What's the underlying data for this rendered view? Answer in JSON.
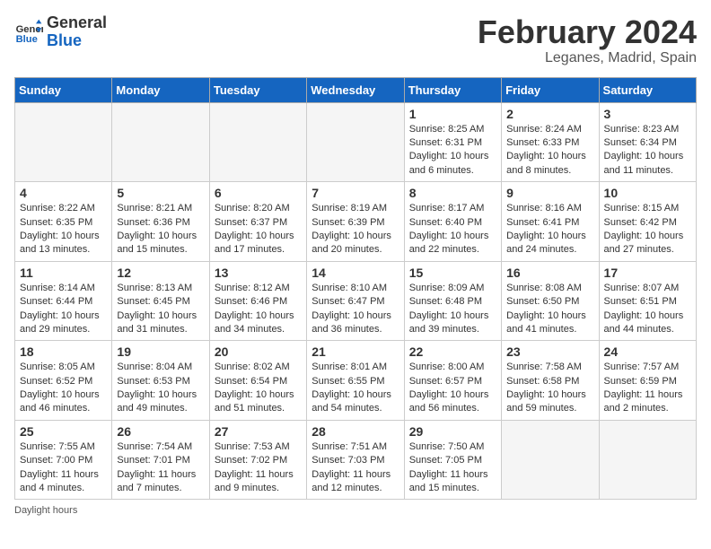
{
  "header": {
    "logo_general": "General",
    "logo_blue": "Blue",
    "title": "February 2024",
    "subtitle": "Leganes, Madrid, Spain"
  },
  "weekdays": [
    "Sunday",
    "Monday",
    "Tuesday",
    "Wednesday",
    "Thursday",
    "Friday",
    "Saturday"
  ],
  "weeks": [
    [
      {
        "day": "",
        "info": ""
      },
      {
        "day": "",
        "info": ""
      },
      {
        "day": "",
        "info": ""
      },
      {
        "day": "",
        "info": ""
      },
      {
        "day": "1",
        "info": "Sunrise: 8:25 AM\nSunset: 6:31 PM\nDaylight: 10 hours\nand 6 minutes."
      },
      {
        "day": "2",
        "info": "Sunrise: 8:24 AM\nSunset: 6:33 PM\nDaylight: 10 hours\nand 8 minutes."
      },
      {
        "day": "3",
        "info": "Sunrise: 8:23 AM\nSunset: 6:34 PM\nDaylight: 10 hours\nand 11 minutes."
      }
    ],
    [
      {
        "day": "4",
        "info": "Sunrise: 8:22 AM\nSunset: 6:35 PM\nDaylight: 10 hours\nand 13 minutes."
      },
      {
        "day": "5",
        "info": "Sunrise: 8:21 AM\nSunset: 6:36 PM\nDaylight: 10 hours\nand 15 minutes."
      },
      {
        "day": "6",
        "info": "Sunrise: 8:20 AM\nSunset: 6:37 PM\nDaylight: 10 hours\nand 17 minutes."
      },
      {
        "day": "7",
        "info": "Sunrise: 8:19 AM\nSunset: 6:39 PM\nDaylight: 10 hours\nand 20 minutes."
      },
      {
        "day": "8",
        "info": "Sunrise: 8:17 AM\nSunset: 6:40 PM\nDaylight: 10 hours\nand 22 minutes."
      },
      {
        "day": "9",
        "info": "Sunrise: 8:16 AM\nSunset: 6:41 PM\nDaylight: 10 hours\nand 24 minutes."
      },
      {
        "day": "10",
        "info": "Sunrise: 8:15 AM\nSunset: 6:42 PM\nDaylight: 10 hours\nand 27 minutes."
      }
    ],
    [
      {
        "day": "11",
        "info": "Sunrise: 8:14 AM\nSunset: 6:44 PM\nDaylight: 10 hours\nand 29 minutes."
      },
      {
        "day": "12",
        "info": "Sunrise: 8:13 AM\nSunset: 6:45 PM\nDaylight: 10 hours\nand 31 minutes."
      },
      {
        "day": "13",
        "info": "Sunrise: 8:12 AM\nSunset: 6:46 PM\nDaylight: 10 hours\nand 34 minutes."
      },
      {
        "day": "14",
        "info": "Sunrise: 8:10 AM\nSunset: 6:47 PM\nDaylight: 10 hours\nand 36 minutes."
      },
      {
        "day": "15",
        "info": "Sunrise: 8:09 AM\nSunset: 6:48 PM\nDaylight: 10 hours\nand 39 minutes."
      },
      {
        "day": "16",
        "info": "Sunrise: 8:08 AM\nSunset: 6:50 PM\nDaylight: 10 hours\nand 41 minutes."
      },
      {
        "day": "17",
        "info": "Sunrise: 8:07 AM\nSunset: 6:51 PM\nDaylight: 10 hours\nand 44 minutes."
      }
    ],
    [
      {
        "day": "18",
        "info": "Sunrise: 8:05 AM\nSunset: 6:52 PM\nDaylight: 10 hours\nand 46 minutes."
      },
      {
        "day": "19",
        "info": "Sunrise: 8:04 AM\nSunset: 6:53 PM\nDaylight: 10 hours\nand 49 minutes."
      },
      {
        "day": "20",
        "info": "Sunrise: 8:02 AM\nSunset: 6:54 PM\nDaylight: 10 hours\nand 51 minutes."
      },
      {
        "day": "21",
        "info": "Sunrise: 8:01 AM\nSunset: 6:55 PM\nDaylight: 10 hours\nand 54 minutes."
      },
      {
        "day": "22",
        "info": "Sunrise: 8:00 AM\nSunset: 6:57 PM\nDaylight: 10 hours\nand 56 minutes."
      },
      {
        "day": "23",
        "info": "Sunrise: 7:58 AM\nSunset: 6:58 PM\nDaylight: 10 hours\nand 59 minutes."
      },
      {
        "day": "24",
        "info": "Sunrise: 7:57 AM\nSunset: 6:59 PM\nDaylight: 11 hours\nand 2 minutes."
      }
    ],
    [
      {
        "day": "25",
        "info": "Sunrise: 7:55 AM\nSunset: 7:00 PM\nDaylight: 11 hours\nand 4 minutes."
      },
      {
        "day": "26",
        "info": "Sunrise: 7:54 AM\nSunset: 7:01 PM\nDaylight: 11 hours\nand 7 minutes."
      },
      {
        "day": "27",
        "info": "Sunrise: 7:53 AM\nSunset: 7:02 PM\nDaylight: 11 hours\nand 9 minutes."
      },
      {
        "day": "28",
        "info": "Sunrise: 7:51 AM\nSunset: 7:03 PM\nDaylight: 11 hours\nand 12 minutes."
      },
      {
        "day": "29",
        "info": "Sunrise: 7:50 AM\nSunset: 7:05 PM\nDaylight: 11 hours\nand 15 minutes."
      },
      {
        "day": "",
        "info": ""
      },
      {
        "day": "",
        "info": ""
      }
    ]
  ],
  "footer": {
    "daylight_label": "Daylight hours"
  }
}
